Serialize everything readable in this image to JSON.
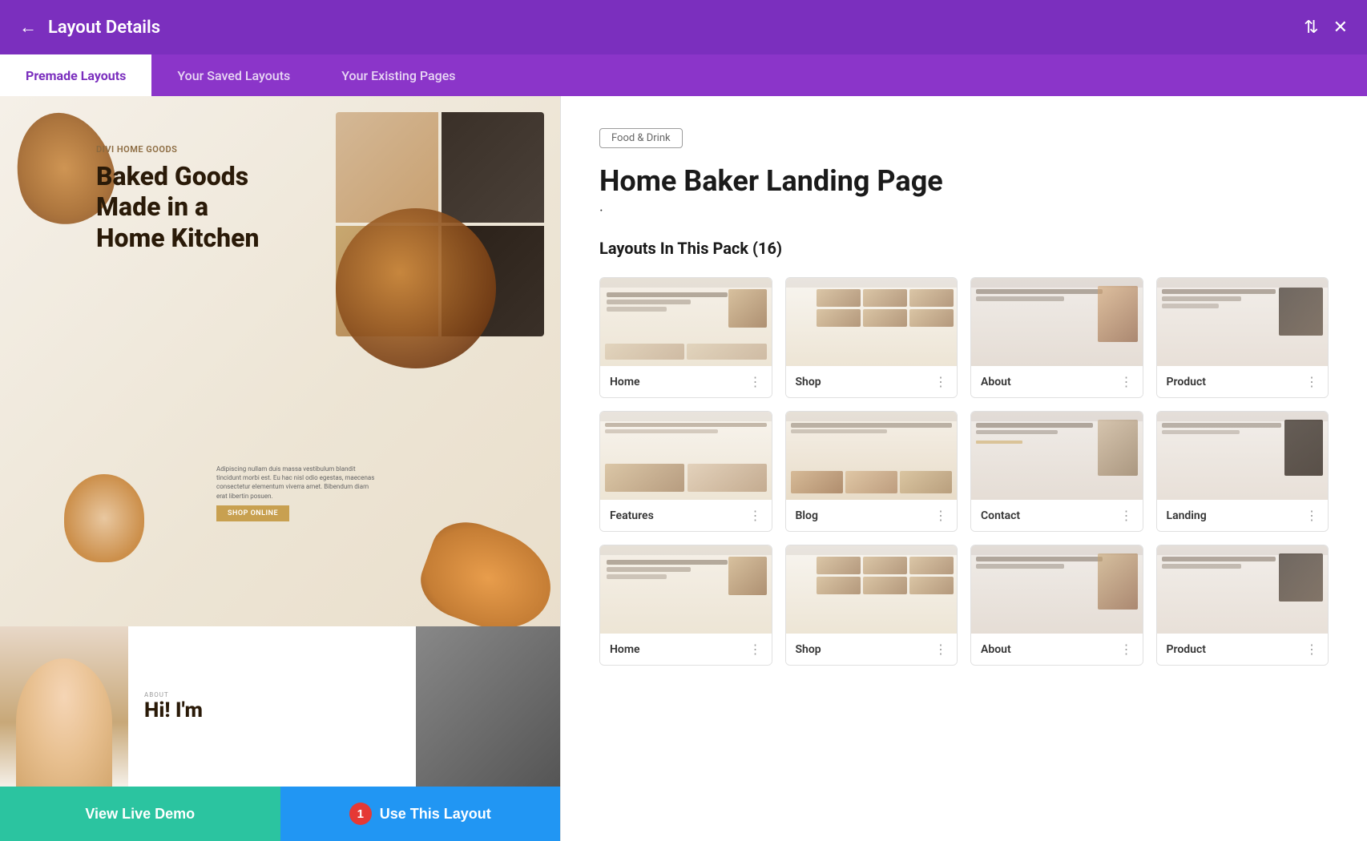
{
  "header": {
    "back_icon": "←",
    "title": "Layout Details",
    "sort_icon": "⇅",
    "close_icon": "✕"
  },
  "tabs": [
    {
      "id": "premade",
      "label": "Premade Layouts",
      "active": true
    },
    {
      "id": "saved",
      "label": "Your Saved Layouts",
      "active": false
    },
    {
      "id": "existing",
      "label": "Your Existing Pages",
      "active": false
    }
  ],
  "preview": {
    "brand": "DIVI HOME GOODS",
    "heading_line1": "Baked Goods",
    "heading_line2": "Made in a",
    "heading_line3": "Home Kitchen",
    "description": "Adipiscing nullam duis massa vestibulum blandit tincidunt morbi est. Eu hac nisl odio egestas, maecenas consectetur elementum viverra amet. Bibendum diam erat libertin posuen.",
    "shop_button": "SHOP ONLINE",
    "about_label": "ABOUT",
    "about_heading": "Hi! I'm"
  },
  "buttons": {
    "view_live_demo": "View Live Demo",
    "use_this_layout": "Use This Layout",
    "badge": "1"
  },
  "detail": {
    "category": "Food & Drink",
    "title": "Home Baker Landing Page",
    "dot": "·",
    "layouts_heading": "Layouts In This Pack (16)"
  },
  "layout_cards": [
    {
      "id": "home",
      "name": "Home"
    },
    {
      "id": "shop",
      "name": "Shop"
    },
    {
      "id": "about",
      "name": "About"
    },
    {
      "id": "product",
      "name": "Product"
    },
    {
      "id": "features",
      "name": "Features"
    },
    {
      "id": "blog",
      "name": "Blog"
    },
    {
      "id": "contact",
      "name": "Contact"
    },
    {
      "id": "landing",
      "name": "Landing"
    },
    {
      "id": "home2",
      "name": "Home"
    },
    {
      "id": "shop2",
      "name": "Shop"
    },
    {
      "id": "about2",
      "name": "About"
    },
    {
      "id": "product2",
      "name": "Product"
    }
  ],
  "menu_dots": "⋮"
}
